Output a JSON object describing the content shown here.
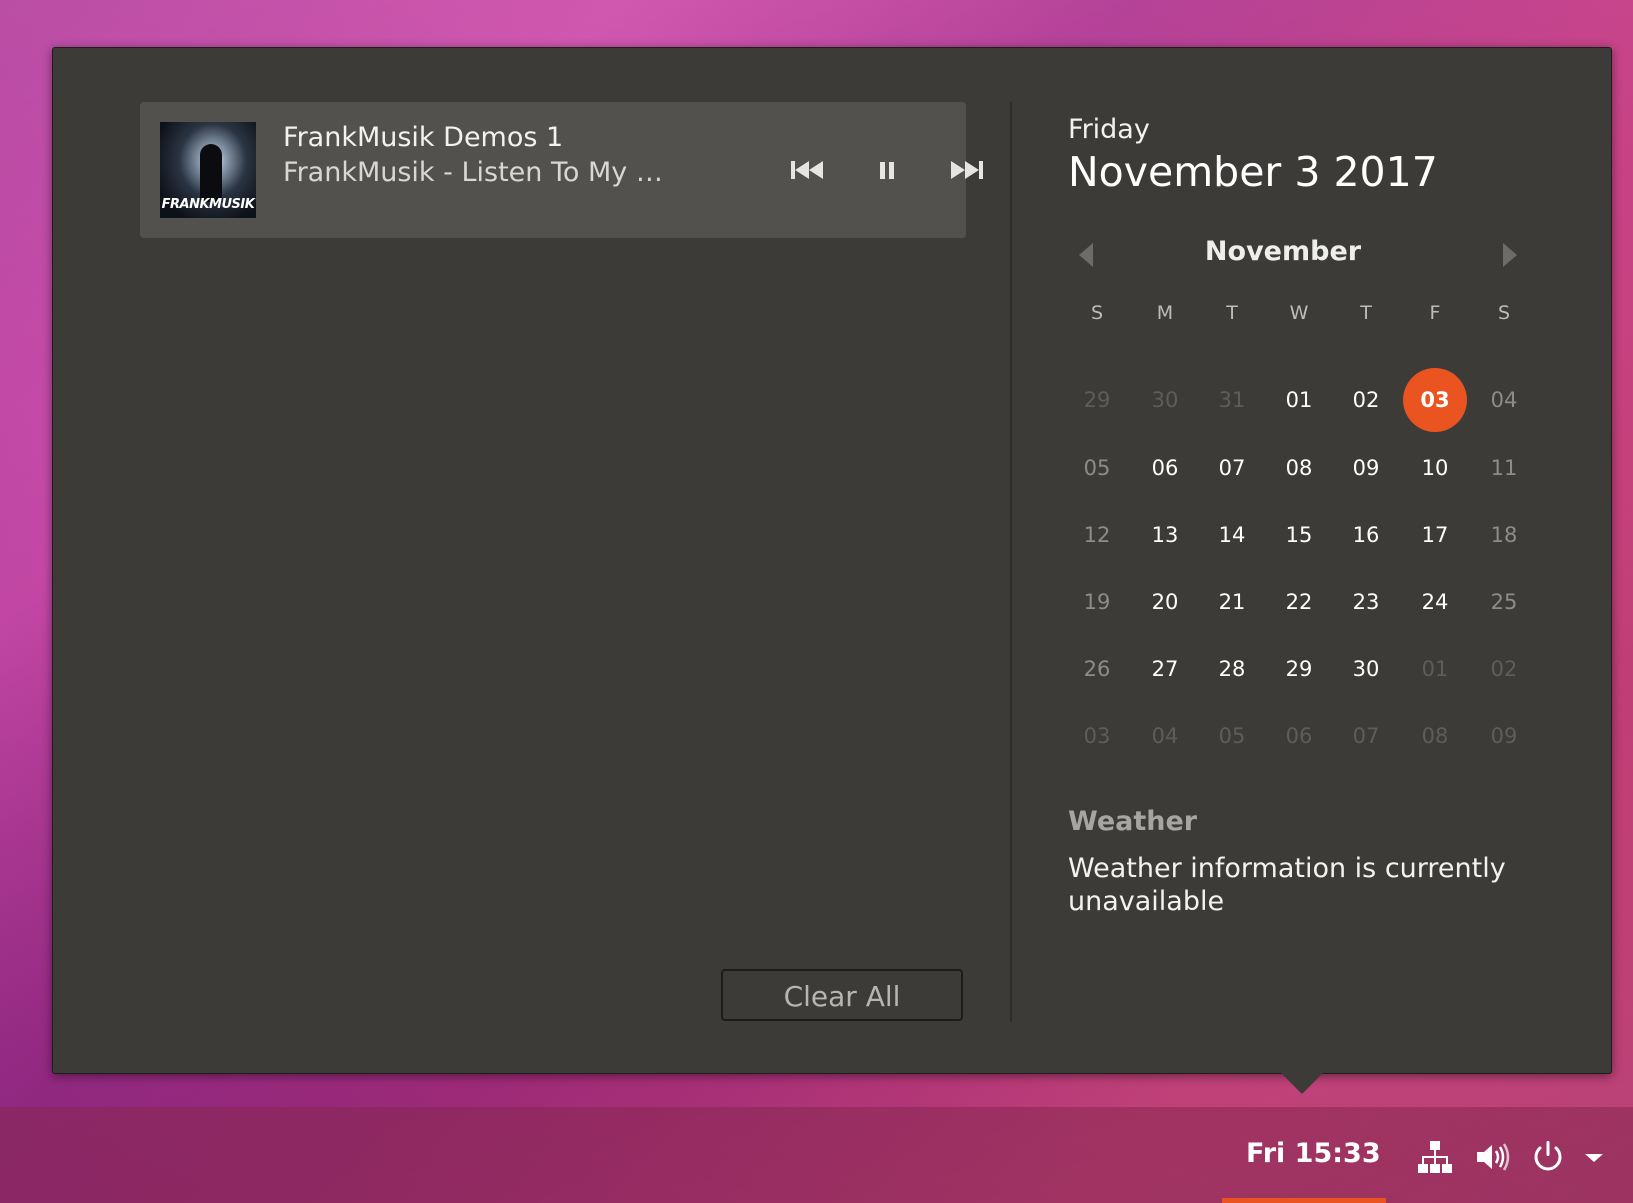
{
  "media": {
    "album_art_text": "FRANKMUSIK",
    "title": "FrankMusik Demos 1",
    "artist_track": "FrankMusik - Listen To My Heart",
    "controls": {
      "prev": "skip-previous-icon",
      "play_state": "pause-icon",
      "next": "skip-next-icon"
    }
  },
  "notifications": {
    "clear_all_label": "Clear All"
  },
  "date": {
    "weekday": "Friday",
    "full": "November  3 2017"
  },
  "calendar": {
    "month": "November",
    "weekdays": [
      "S",
      "M",
      "T",
      "W",
      "T",
      "F",
      "S"
    ],
    "today": "03",
    "weeks": [
      [
        "29",
        "30",
        "31",
        "01",
        "02",
        "03",
        "04"
      ],
      [
        "05",
        "06",
        "07",
        "08",
        "09",
        "10",
        "11"
      ],
      [
        "12",
        "13",
        "14",
        "15",
        "16",
        "17",
        "18"
      ],
      [
        "19",
        "20",
        "21",
        "22",
        "23",
        "24",
        "25"
      ],
      [
        "26",
        "27",
        "28",
        "29",
        "30",
        "01",
        "02"
      ],
      [
        "03",
        "04",
        "05",
        "06",
        "07",
        "08",
        "09"
      ]
    ]
  },
  "weather": {
    "title": "Weather",
    "message": "Weather information is currently unavailable"
  },
  "topbar": {
    "clock": "Fri 15:33",
    "icons": [
      "network-icon",
      "volume-icon",
      "power-icon",
      "dropdown-arrow-icon"
    ]
  },
  "colors": {
    "accent": "#e95420",
    "panel_bg": "#3c3b37",
    "media_card_bg": "#52514d"
  }
}
